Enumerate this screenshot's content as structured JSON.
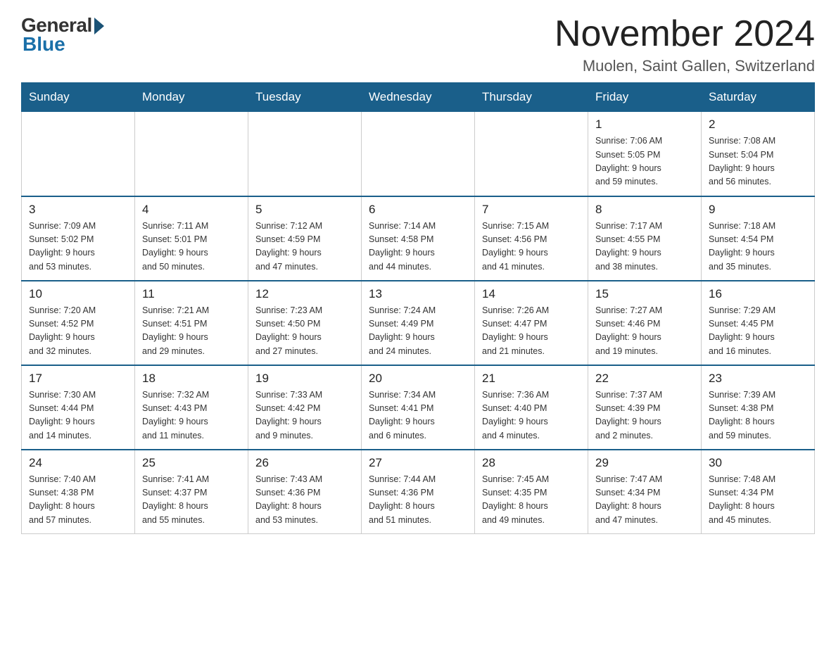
{
  "logo": {
    "general": "General",
    "blue": "Blue"
  },
  "title": "November 2024",
  "location": "Muolen, Saint Gallen, Switzerland",
  "days_of_week": [
    "Sunday",
    "Monday",
    "Tuesday",
    "Wednesday",
    "Thursday",
    "Friday",
    "Saturday"
  ],
  "weeks": [
    [
      {
        "day": "",
        "info": ""
      },
      {
        "day": "",
        "info": ""
      },
      {
        "day": "",
        "info": ""
      },
      {
        "day": "",
        "info": ""
      },
      {
        "day": "",
        "info": ""
      },
      {
        "day": "1",
        "info": "Sunrise: 7:06 AM\nSunset: 5:05 PM\nDaylight: 9 hours\nand 59 minutes."
      },
      {
        "day": "2",
        "info": "Sunrise: 7:08 AM\nSunset: 5:04 PM\nDaylight: 9 hours\nand 56 minutes."
      }
    ],
    [
      {
        "day": "3",
        "info": "Sunrise: 7:09 AM\nSunset: 5:02 PM\nDaylight: 9 hours\nand 53 minutes."
      },
      {
        "day": "4",
        "info": "Sunrise: 7:11 AM\nSunset: 5:01 PM\nDaylight: 9 hours\nand 50 minutes."
      },
      {
        "day": "5",
        "info": "Sunrise: 7:12 AM\nSunset: 4:59 PM\nDaylight: 9 hours\nand 47 minutes."
      },
      {
        "day": "6",
        "info": "Sunrise: 7:14 AM\nSunset: 4:58 PM\nDaylight: 9 hours\nand 44 minutes."
      },
      {
        "day": "7",
        "info": "Sunrise: 7:15 AM\nSunset: 4:56 PM\nDaylight: 9 hours\nand 41 minutes."
      },
      {
        "day": "8",
        "info": "Sunrise: 7:17 AM\nSunset: 4:55 PM\nDaylight: 9 hours\nand 38 minutes."
      },
      {
        "day": "9",
        "info": "Sunrise: 7:18 AM\nSunset: 4:54 PM\nDaylight: 9 hours\nand 35 minutes."
      }
    ],
    [
      {
        "day": "10",
        "info": "Sunrise: 7:20 AM\nSunset: 4:52 PM\nDaylight: 9 hours\nand 32 minutes."
      },
      {
        "day": "11",
        "info": "Sunrise: 7:21 AM\nSunset: 4:51 PM\nDaylight: 9 hours\nand 29 minutes."
      },
      {
        "day": "12",
        "info": "Sunrise: 7:23 AM\nSunset: 4:50 PM\nDaylight: 9 hours\nand 27 minutes."
      },
      {
        "day": "13",
        "info": "Sunrise: 7:24 AM\nSunset: 4:49 PM\nDaylight: 9 hours\nand 24 minutes."
      },
      {
        "day": "14",
        "info": "Sunrise: 7:26 AM\nSunset: 4:47 PM\nDaylight: 9 hours\nand 21 minutes."
      },
      {
        "day": "15",
        "info": "Sunrise: 7:27 AM\nSunset: 4:46 PM\nDaylight: 9 hours\nand 19 minutes."
      },
      {
        "day": "16",
        "info": "Sunrise: 7:29 AM\nSunset: 4:45 PM\nDaylight: 9 hours\nand 16 minutes."
      }
    ],
    [
      {
        "day": "17",
        "info": "Sunrise: 7:30 AM\nSunset: 4:44 PM\nDaylight: 9 hours\nand 14 minutes."
      },
      {
        "day": "18",
        "info": "Sunrise: 7:32 AM\nSunset: 4:43 PM\nDaylight: 9 hours\nand 11 minutes."
      },
      {
        "day": "19",
        "info": "Sunrise: 7:33 AM\nSunset: 4:42 PM\nDaylight: 9 hours\nand 9 minutes."
      },
      {
        "day": "20",
        "info": "Sunrise: 7:34 AM\nSunset: 4:41 PM\nDaylight: 9 hours\nand 6 minutes."
      },
      {
        "day": "21",
        "info": "Sunrise: 7:36 AM\nSunset: 4:40 PM\nDaylight: 9 hours\nand 4 minutes."
      },
      {
        "day": "22",
        "info": "Sunrise: 7:37 AM\nSunset: 4:39 PM\nDaylight: 9 hours\nand 2 minutes."
      },
      {
        "day": "23",
        "info": "Sunrise: 7:39 AM\nSunset: 4:38 PM\nDaylight: 8 hours\nand 59 minutes."
      }
    ],
    [
      {
        "day": "24",
        "info": "Sunrise: 7:40 AM\nSunset: 4:38 PM\nDaylight: 8 hours\nand 57 minutes."
      },
      {
        "day": "25",
        "info": "Sunrise: 7:41 AM\nSunset: 4:37 PM\nDaylight: 8 hours\nand 55 minutes."
      },
      {
        "day": "26",
        "info": "Sunrise: 7:43 AM\nSunset: 4:36 PM\nDaylight: 8 hours\nand 53 minutes."
      },
      {
        "day": "27",
        "info": "Sunrise: 7:44 AM\nSunset: 4:36 PM\nDaylight: 8 hours\nand 51 minutes."
      },
      {
        "day": "28",
        "info": "Sunrise: 7:45 AM\nSunset: 4:35 PM\nDaylight: 8 hours\nand 49 minutes."
      },
      {
        "day": "29",
        "info": "Sunrise: 7:47 AM\nSunset: 4:34 PM\nDaylight: 8 hours\nand 47 minutes."
      },
      {
        "day": "30",
        "info": "Sunrise: 7:48 AM\nSunset: 4:34 PM\nDaylight: 8 hours\nand 45 minutes."
      }
    ]
  ]
}
